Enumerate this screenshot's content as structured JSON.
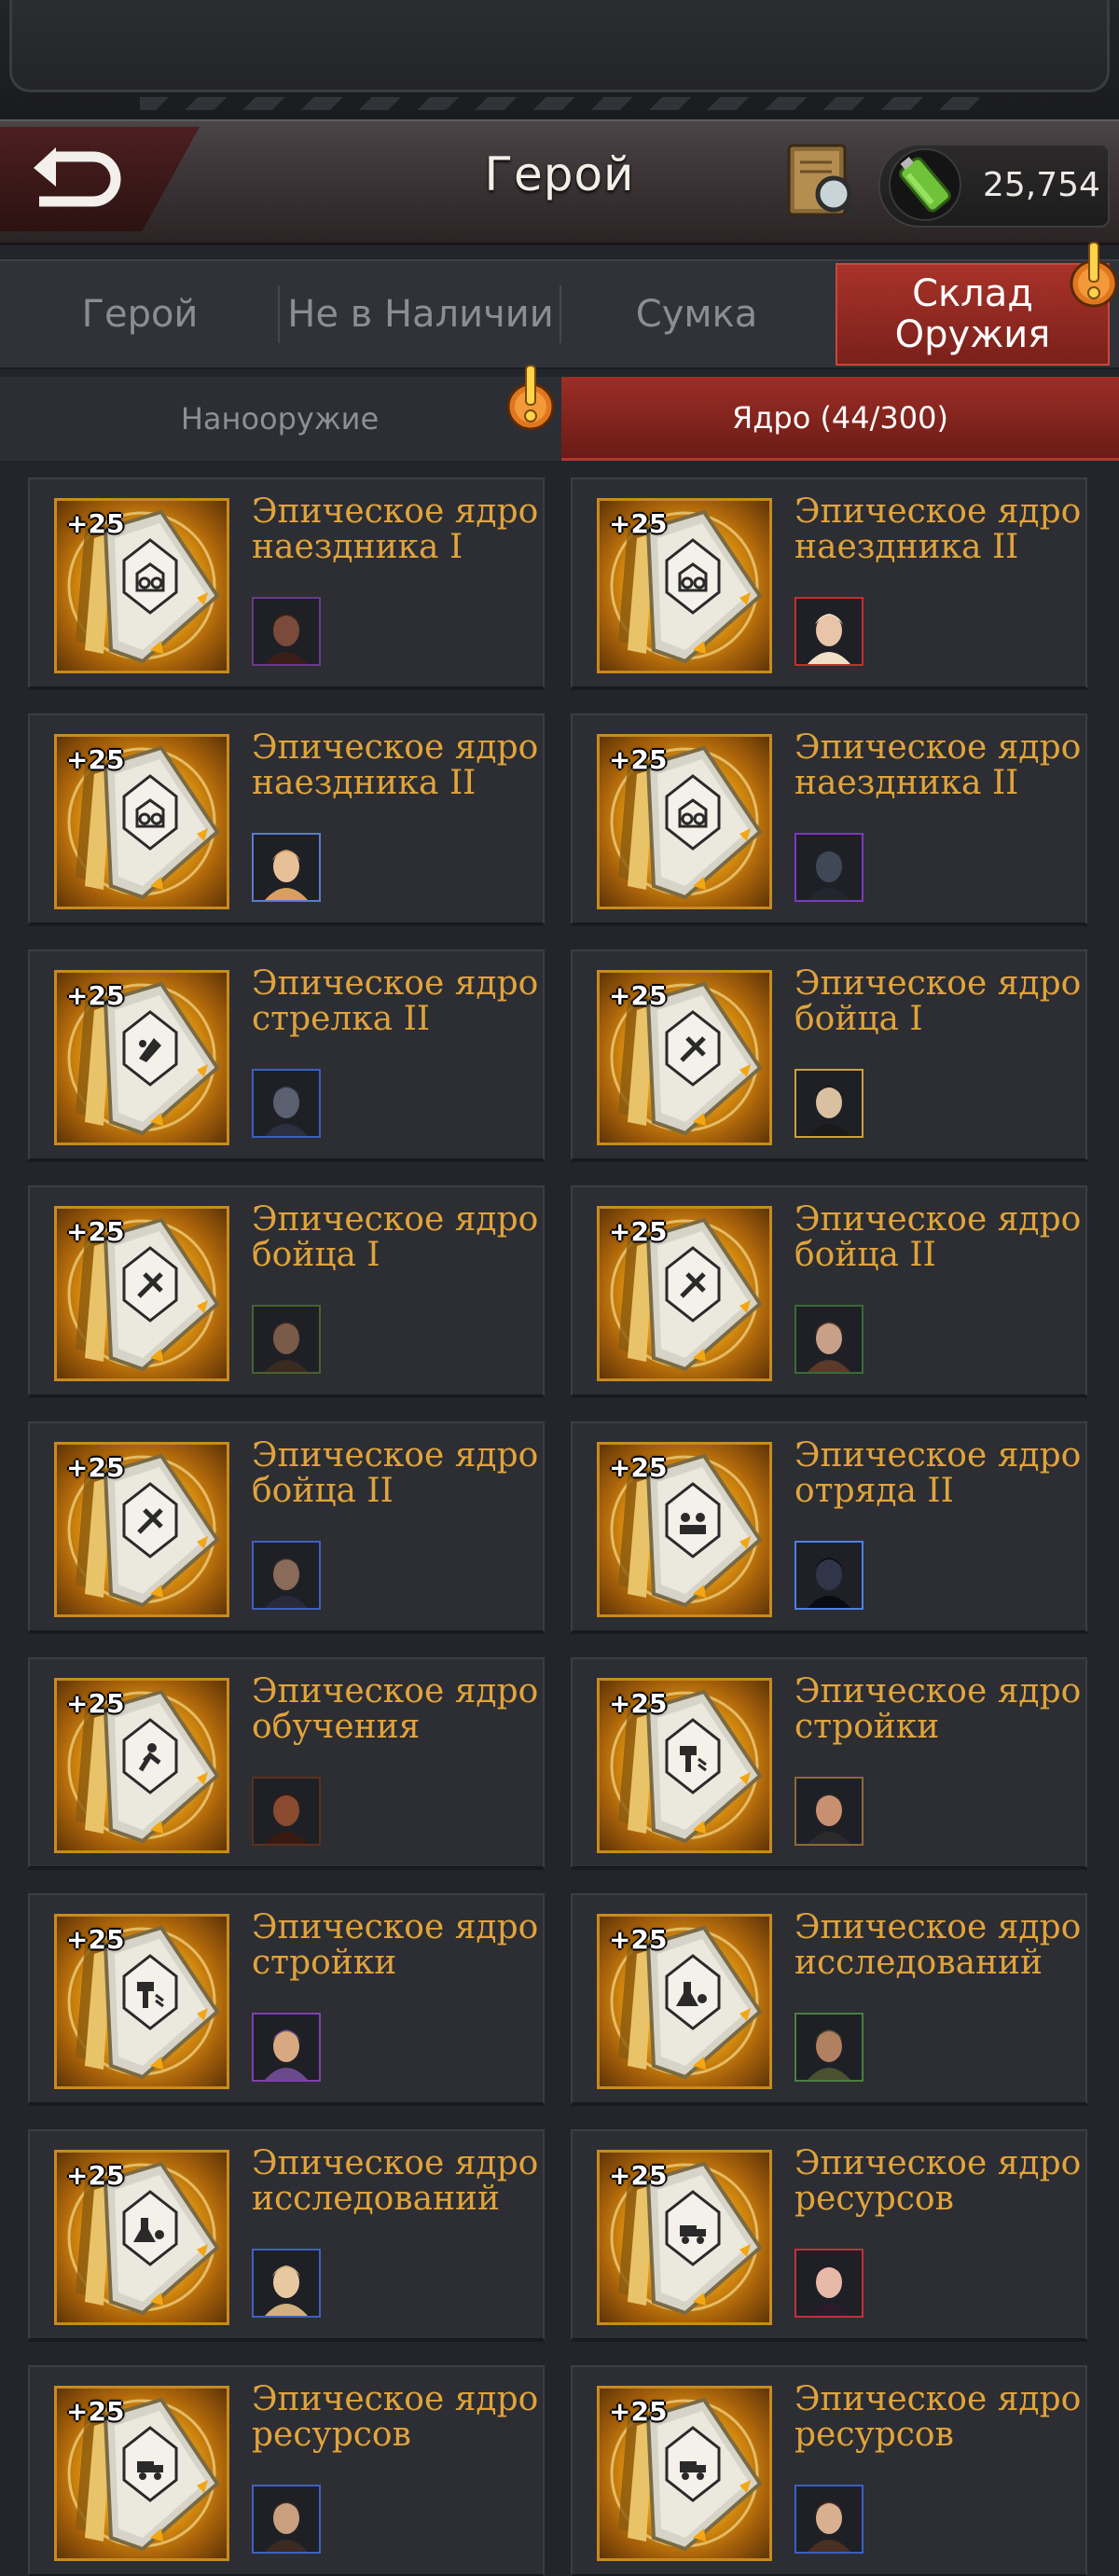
{
  "header": {
    "title": "Герой",
    "currency_value": "25,754"
  },
  "main_tabs": [
    {
      "label": "Герой"
    },
    {
      "label": "Не в Наличии"
    },
    {
      "label": "Сумка"
    },
    {
      "label": "Склад Оружия"
    }
  ],
  "sub_tabs": [
    {
      "label": "Нанооружие"
    },
    {
      "label": "Ядро (44/300)"
    }
  ],
  "cores": [
    {
      "level": "+25",
      "name": "Эпическое ядро наездника I",
      "icon": "rider-core-icon"
    },
    {
      "level": "+25",
      "name": "Эпическое ядро наездника II",
      "icon": "rider-core-icon"
    },
    {
      "level": "+25",
      "name": "Эпическое ядро наездника II",
      "icon": "rider-core-icon"
    },
    {
      "level": "+25",
      "name": "Эпическое ядро наездника II",
      "icon": "rider-core-icon"
    },
    {
      "level": "+25",
      "name": "Эпическое ядро стрелка II",
      "icon": "shooter-core-icon"
    },
    {
      "level": "+25",
      "name": "Эпическое ядро бойца I",
      "icon": "fighter-core-icon"
    },
    {
      "level": "+25",
      "name": "Эпическое ядро бойца I",
      "icon": "fighter-core-icon"
    },
    {
      "level": "+25",
      "name": "Эпическое ядро бойца II",
      "icon": "fighter-core-icon"
    },
    {
      "level": "+25",
      "name": "Эпическое ядро бойца II",
      "icon": "fighter-core-icon"
    },
    {
      "level": "+25",
      "name": "Эпическое ядро отряда II",
      "icon": "squad-core-icon"
    },
    {
      "level": "+25",
      "name": "Эпическое ядро обучения",
      "icon": "training-core-icon"
    },
    {
      "level": "+25",
      "name": "Эпическое ядро стройки",
      "icon": "construction-core-icon"
    },
    {
      "level": "+25",
      "name": "Эпическое ядро стройки",
      "icon": "construction-core-icon"
    },
    {
      "level": "+25",
      "name": "Эпическое ядро исследований",
      "icon": "research-core-icon"
    },
    {
      "level": "+25",
      "name": "Эпическое ядро исследований",
      "icon": "research-core-icon"
    },
    {
      "level": "+25",
      "name": "Эпическое ядро ресурсов",
      "icon": "resources-core-icon"
    },
    {
      "level": "+25",
      "name": "Эпическое ядро ресурсов",
      "icon": "resources-core-icon"
    },
    {
      "level": "+25",
      "name": "Эпическое ядро ресурсов",
      "icon": "resources-core-icon"
    }
  ],
  "colors": {
    "accent_red": "#a8332a",
    "gold_text": "#e0a33c",
    "background": "#23252b"
  }
}
